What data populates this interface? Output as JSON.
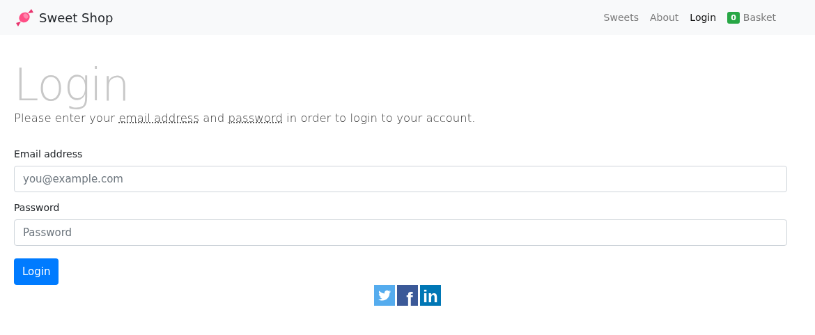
{
  "navbar": {
    "brand": "Sweet Shop",
    "items": [
      {
        "label": "Sweets",
        "selected": false
      },
      {
        "label": "About",
        "selected": false
      },
      {
        "label": "Login",
        "selected": true
      }
    ],
    "basket": {
      "count": "0",
      "label": "Basket"
    }
  },
  "heading": "Login",
  "lead": [
    {
      "text": "Please enter your ",
      "abbr": false
    },
    {
      "text": "email address",
      "abbr": true
    },
    {
      "text": " and ",
      "abbr": false
    },
    {
      "text": "password",
      "abbr": true
    },
    {
      "text": " in order to login to your account.",
      "abbr": false
    }
  ],
  "fields": [
    {
      "label": "Email address",
      "placeholder": "you@example.com"
    },
    {
      "label": "Password",
      "placeholder": "Password"
    }
  ],
  "button": "Login",
  "social": [
    {
      "kind": "twitter"
    },
    {
      "kind": "facebook",
      "glyph": "f"
    },
    {
      "kind": "linkedin",
      "glyph": "in"
    }
  ]
}
